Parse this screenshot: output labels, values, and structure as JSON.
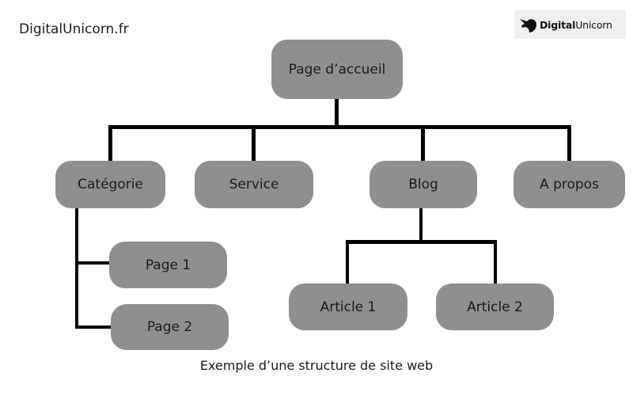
{
  "site_label": "DigitalUnicorn.fr",
  "logo": {
    "icon": "unicorn-head-icon",
    "text_bold": "Digital",
    "text_regular": "Unicorn"
  },
  "diagram": {
    "root": "Page d’accueil",
    "level1": [
      "Catégorie",
      "Service",
      "Blog",
      "A propos"
    ],
    "categorie_children": [
      "Page 1",
      "Page 2"
    ],
    "blog_children": [
      "Article 1",
      "Article 2"
    ]
  },
  "caption": "Exemple d’une structure de site web"
}
